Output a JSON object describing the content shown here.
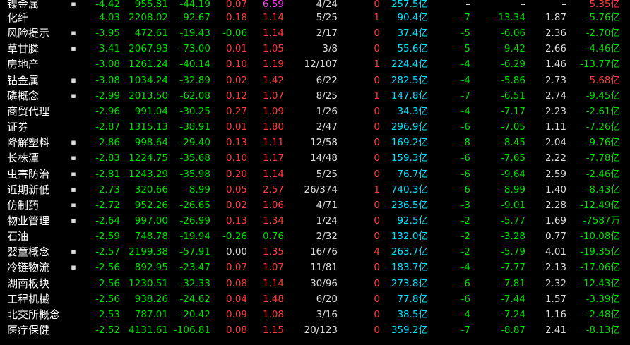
{
  "colors": {
    "background": "#000000",
    "up": "#ff3b3b",
    "down": "#00e000",
    "flat": "#dcdcdc",
    "amount": "#00e5ff",
    "highlight": "#ff3cff"
  },
  "rows": [
    {
      "name": "镍金属",
      "dot": "▪",
      "pct": "-4.42",
      "price": "955.81",
      "chg": "-44.19",
      "spd": "0.07",
      "vr": "6.59",
      "ud": "4/24",
      "lead": "0",
      "amt": "257.5亿",
      "f1": "–",
      "f2": "–",
      "f3": "–",
      "f4": "5.35亿",
      "c": {
        "pct": "green",
        "price": "green",
        "chg": "green",
        "spd": "red",
        "vr": "magenta",
        "lead": "red",
        "f1": "white",
        "f2": "white",
        "f3": "white",
        "f4": "red"
      }
    },
    {
      "name": "化纤",
      "dot": "",
      "pct": "-4.03",
      "price": "2208.02",
      "chg": "-92.67",
      "spd": "0.18",
      "vr": "1.14",
      "ud": "5/25",
      "lead": "1",
      "amt": "90.4亿",
      "f1": "-7",
      "f2": "-13.34",
      "f3": "1.87",
      "f4": "-5.76亿",
      "c": {
        "pct": "green",
        "price": "green",
        "chg": "green",
        "spd": "red",
        "vr": "red",
        "lead": "red",
        "f1": "green",
        "f2": "green",
        "f3": "white",
        "f4": "green"
      }
    },
    {
      "name": "风险提示",
      "dot": "▪",
      "pct": "-3.95",
      "price": "472.61",
      "chg": "-19.43",
      "spd": "-0.06",
      "vr": "1.14",
      "ud": "2/17",
      "lead": "0",
      "amt": "37.4亿",
      "f1": "-5",
      "f2": "-6.06",
      "f3": "2.36",
      "f4": "-2.70亿",
      "c": {
        "pct": "green",
        "price": "green",
        "chg": "green",
        "spd": "green",
        "vr": "red",
        "lead": "red",
        "f1": "green",
        "f2": "green",
        "f3": "white",
        "f4": "green"
      }
    },
    {
      "name": "草甘膦",
      "dot": "▪",
      "pct": "-3.41",
      "price": "2067.93",
      "chg": "-73.00",
      "spd": "0.01",
      "vr": "1.05",
      "ud": "3/8",
      "lead": "0",
      "amt": "55.6亿",
      "f1": "-5",
      "f2": "-9.42",
      "f3": "2.66",
      "f4": "-4.46亿",
      "c": {
        "pct": "green",
        "price": "green",
        "chg": "green",
        "spd": "red",
        "vr": "red",
        "lead": "red",
        "f1": "green",
        "f2": "green",
        "f3": "white",
        "f4": "green"
      }
    },
    {
      "name": "房地产",
      "dot": "",
      "pct": "-3.08",
      "price": "1261.24",
      "chg": "-40.14",
      "spd": "0.10",
      "vr": "1.19",
      "ud": "12/107",
      "lead": "1",
      "amt": "224.4亿",
      "f1": "-4",
      "f2": "-6.29",
      "f3": "1.46",
      "f4": "-13.77亿",
      "c": {
        "pct": "green",
        "price": "green",
        "chg": "green",
        "spd": "red",
        "vr": "red",
        "lead": "red",
        "f1": "green",
        "f2": "green",
        "f3": "white",
        "f4": "green"
      }
    },
    {
      "name": "钴金属",
      "dot": "▪",
      "pct": "-3.08",
      "price": "1034.24",
      "chg": "-32.89",
      "spd": "0.02",
      "vr": "1.42",
      "ud": "6/22",
      "lead": "0",
      "amt": "282.5亿",
      "f1": "-4",
      "f2": "-5.86",
      "f3": "2.73",
      "f4": "5.68亿",
      "c": {
        "pct": "green",
        "price": "green",
        "chg": "green",
        "spd": "red",
        "vr": "red",
        "lead": "red",
        "f1": "green",
        "f2": "green",
        "f3": "white",
        "f4": "red"
      }
    },
    {
      "name": "磷概念",
      "dot": "▪",
      "pct": "-2.99",
      "price": "2013.50",
      "chg": "-62.08",
      "spd": "0.12",
      "vr": "1.07",
      "ud": "8/25",
      "lead": "1",
      "amt": "147.8亿",
      "f1": "-7",
      "f2": "-6.51",
      "f3": "2.74",
      "f4": "-9.45亿",
      "c": {
        "pct": "green",
        "price": "green",
        "chg": "green",
        "spd": "red",
        "vr": "red",
        "lead": "red",
        "f1": "green",
        "f2": "green",
        "f3": "white",
        "f4": "green"
      }
    },
    {
      "name": "商贸代理",
      "dot": "",
      "pct": "-2.96",
      "price": "991.04",
      "chg": "-30.25",
      "spd": "0.27",
      "vr": "1.09",
      "ud": "1/26",
      "lead": "0",
      "amt": "34.3亿",
      "f1": "-4",
      "f2": "-7.17",
      "f3": "2.23",
      "f4": "-2.61亿",
      "c": {
        "pct": "green",
        "price": "green",
        "chg": "green",
        "spd": "red",
        "vr": "red",
        "lead": "red",
        "f1": "green",
        "f2": "green",
        "f3": "white",
        "f4": "green"
      }
    },
    {
      "name": "证券",
      "dot": "",
      "pct": "-2.87",
      "price": "1315.13",
      "chg": "-38.91",
      "spd": "0.01",
      "vr": "1.80",
      "ud": "2/47",
      "lead": "0",
      "amt": "296.9亿",
      "f1": "-6",
      "f2": "-7.05",
      "f3": "1.11",
      "f4": "-7.26亿",
      "c": {
        "pct": "green",
        "price": "green",
        "chg": "green",
        "spd": "red",
        "vr": "red",
        "lead": "red",
        "f1": "green",
        "f2": "green",
        "f3": "white",
        "f4": "green"
      }
    },
    {
      "name": "降解塑料",
      "dot": "▪",
      "pct": "-2.86",
      "price": "998.64",
      "chg": "-29.40",
      "spd": "0.13",
      "vr": "1.11",
      "ud": "12/58",
      "lead": "0",
      "amt": "169.2亿",
      "f1": "-8",
      "f2": "-8.45",
      "f3": "2.04",
      "f4": "-9.76亿",
      "c": {
        "pct": "green",
        "price": "green",
        "chg": "green",
        "spd": "red",
        "vr": "red",
        "lead": "red",
        "f1": "green",
        "f2": "green",
        "f3": "white",
        "f4": "green"
      }
    },
    {
      "name": "长株潭",
      "dot": "▪",
      "pct": "-2.83",
      "price": "1224.75",
      "chg": "-35.68",
      "spd": "0.10",
      "vr": "1.17",
      "ud": "14/48",
      "lead": "0",
      "amt": "159.3亿",
      "f1": "-6",
      "f2": "-7.65",
      "f3": "2.22",
      "f4": "-7.78亿",
      "c": {
        "pct": "green",
        "price": "green",
        "chg": "green",
        "spd": "red",
        "vr": "red",
        "lead": "red",
        "f1": "green",
        "f2": "green",
        "f3": "white",
        "f4": "green"
      }
    },
    {
      "name": "虫害防治",
      "dot": "▪",
      "pct": "-2.81",
      "price": "1243.29",
      "chg": "-35.98",
      "spd": "0.20",
      "vr": "1.14",
      "ud": "5/25",
      "lead": "0",
      "amt": "76.7亿",
      "f1": "-6",
      "f2": "-9.64",
      "f3": "2.59",
      "f4": "-2.46亿",
      "c": {
        "pct": "green",
        "price": "green",
        "chg": "green",
        "spd": "red",
        "vr": "red",
        "lead": "red",
        "f1": "green",
        "f2": "green",
        "f3": "white",
        "f4": "green"
      }
    },
    {
      "name": "近期新低",
      "dot": "▪",
      "pct": "-2.73",
      "price": "320.66",
      "chg": "-8.99",
      "spd": "0.05",
      "vr": "2.57",
      "ud": "26/374",
      "lead": "1",
      "amt": "740.3亿",
      "f1": "-6",
      "f2": "-8.99",
      "f3": "1.40",
      "f4": "-8.43亿",
      "c": {
        "pct": "green",
        "price": "green",
        "chg": "green",
        "spd": "red",
        "vr": "red",
        "lead": "red",
        "f1": "green",
        "f2": "green",
        "f3": "white",
        "f4": "green"
      }
    },
    {
      "name": "仿制药",
      "dot": "▪",
      "pct": "-2.72",
      "price": "952.26",
      "chg": "-26.65",
      "spd": "0.02",
      "vr": "1.06",
      "ud": "4/71",
      "lead": "0",
      "amt": "236.5亿",
      "f1": "-3",
      "f2": "-9.01",
      "f3": "2.28",
      "f4": "-12.49亿",
      "c": {
        "pct": "green",
        "price": "green",
        "chg": "green",
        "spd": "red",
        "vr": "red",
        "lead": "red",
        "f1": "green",
        "f2": "green",
        "f3": "white",
        "f4": "green"
      }
    },
    {
      "name": "物业管理",
      "dot": "▪",
      "pct": "-2.64",
      "price": "997.00",
      "chg": "-26.99",
      "spd": "0.13",
      "vr": "1.34",
      "ud": "1/24",
      "lead": "0",
      "amt": "92.5亿",
      "f1": "-2",
      "f2": "-5.77",
      "f3": "1.69",
      "f4": "-7587万",
      "c": {
        "pct": "green",
        "price": "green",
        "chg": "green",
        "spd": "red",
        "vr": "red",
        "lead": "red",
        "f1": "green",
        "f2": "green",
        "f3": "white",
        "f4": "green"
      }
    },
    {
      "name": "石油",
      "dot": "",
      "pct": "-2.59",
      "price": "748.78",
      "chg": "-19.94",
      "spd": "-0.26",
      "vr": "0.76",
      "ud": "2/32",
      "lead": "0",
      "amt": "132.0亿",
      "f1": "-2",
      "f2": "-3.28",
      "f3": "0.77",
      "f4": "-10.08亿",
      "c": {
        "pct": "green",
        "price": "green",
        "chg": "green",
        "spd": "green",
        "vr": "green",
        "lead": "red",
        "f1": "green",
        "f2": "green",
        "f3": "white",
        "f4": "green"
      }
    },
    {
      "name": "婴童概念",
      "dot": "▪",
      "pct": "-2.57",
      "price": "2199.38",
      "chg": "-57.91",
      "spd": "0.00",
      "vr": "1.35",
      "ud": "16/76",
      "lead": "4",
      "amt": "263.7亿",
      "f1": "-2",
      "f2": "-5.79",
      "f3": "4.01",
      "f4": "-19.35亿",
      "c": {
        "pct": "green",
        "price": "green",
        "chg": "green",
        "spd": "white",
        "vr": "red",
        "lead": "red",
        "f1": "green",
        "f2": "green",
        "f3": "white",
        "f4": "green"
      }
    },
    {
      "name": "冷链物流",
      "dot": "▪",
      "pct": "-2.56",
      "price": "892.95",
      "chg": "-23.47",
      "spd": "0.07",
      "vr": "1.07",
      "ud": "11/81",
      "lead": "0",
      "amt": "183.7亿",
      "f1": "-4",
      "f2": "-7.77",
      "f3": "2.13",
      "f4": "-17.06亿",
      "c": {
        "pct": "green",
        "price": "green",
        "chg": "green",
        "spd": "red",
        "vr": "red",
        "lead": "red",
        "f1": "green",
        "f2": "green",
        "f3": "white",
        "f4": "green"
      }
    },
    {
      "name": "湖南板块",
      "dot": "",
      "pct": "-2.56",
      "price": "1230.51",
      "chg": "-32.33",
      "spd": "0.08",
      "vr": "1.14",
      "ud": "30/96",
      "lead": "0",
      "amt": "273.8亿",
      "f1": "-6",
      "f2": "-7.81",
      "f3": "2.32",
      "f4": "-12.43亿",
      "c": {
        "pct": "green",
        "price": "green",
        "chg": "green",
        "spd": "red",
        "vr": "red",
        "lead": "red",
        "f1": "green",
        "f2": "green",
        "f3": "white",
        "f4": "green"
      }
    },
    {
      "name": "工程机械",
      "dot": "",
      "pct": "-2.56",
      "price": "938.26",
      "chg": "-24.62",
      "spd": "0.04",
      "vr": "1.48",
      "ud": "6/20",
      "lead": "0",
      "amt": "77.8亿",
      "f1": "-6",
      "f2": "-7.44",
      "f3": "1.57",
      "f4": "-3.39亿",
      "c": {
        "pct": "green",
        "price": "green",
        "chg": "green",
        "spd": "red",
        "vr": "red",
        "lead": "red",
        "f1": "green",
        "f2": "green",
        "f3": "white",
        "f4": "green"
      }
    },
    {
      "name": "北交所概念",
      "dot": "",
      "pct": "-2.53",
      "price": "787.01",
      "chg": "-20.42",
      "spd": "0.09",
      "vr": "1.08",
      "ud": "3/16",
      "lead": "0",
      "amt": "38.5亿",
      "f1": "-4",
      "f2": "-7.24",
      "f3": "1.16",
      "f4": "-2.48亿",
      "c": {
        "pct": "green",
        "price": "green",
        "chg": "green",
        "spd": "red",
        "vr": "red",
        "lead": "red",
        "f1": "green",
        "f2": "green",
        "f3": "white",
        "f4": "green"
      }
    },
    {
      "name": "医疗保健",
      "dot": "",
      "pct": "-2.52",
      "price": "4131.61",
      "chg": "-106.81",
      "spd": "0.08",
      "vr": "1.15",
      "ud": "20/123",
      "lead": "0",
      "amt": "359.2亿",
      "f1": "-7",
      "f2": "-8.87",
      "f3": "2.41",
      "f4": "-8.13亿",
      "c": {
        "pct": "green",
        "price": "green",
        "chg": "green",
        "spd": "red",
        "vr": "red",
        "lead": "red",
        "f1": "green",
        "f2": "green",
        "f3": "white",
        "f4": "green"
      }
    }
  ]
}
